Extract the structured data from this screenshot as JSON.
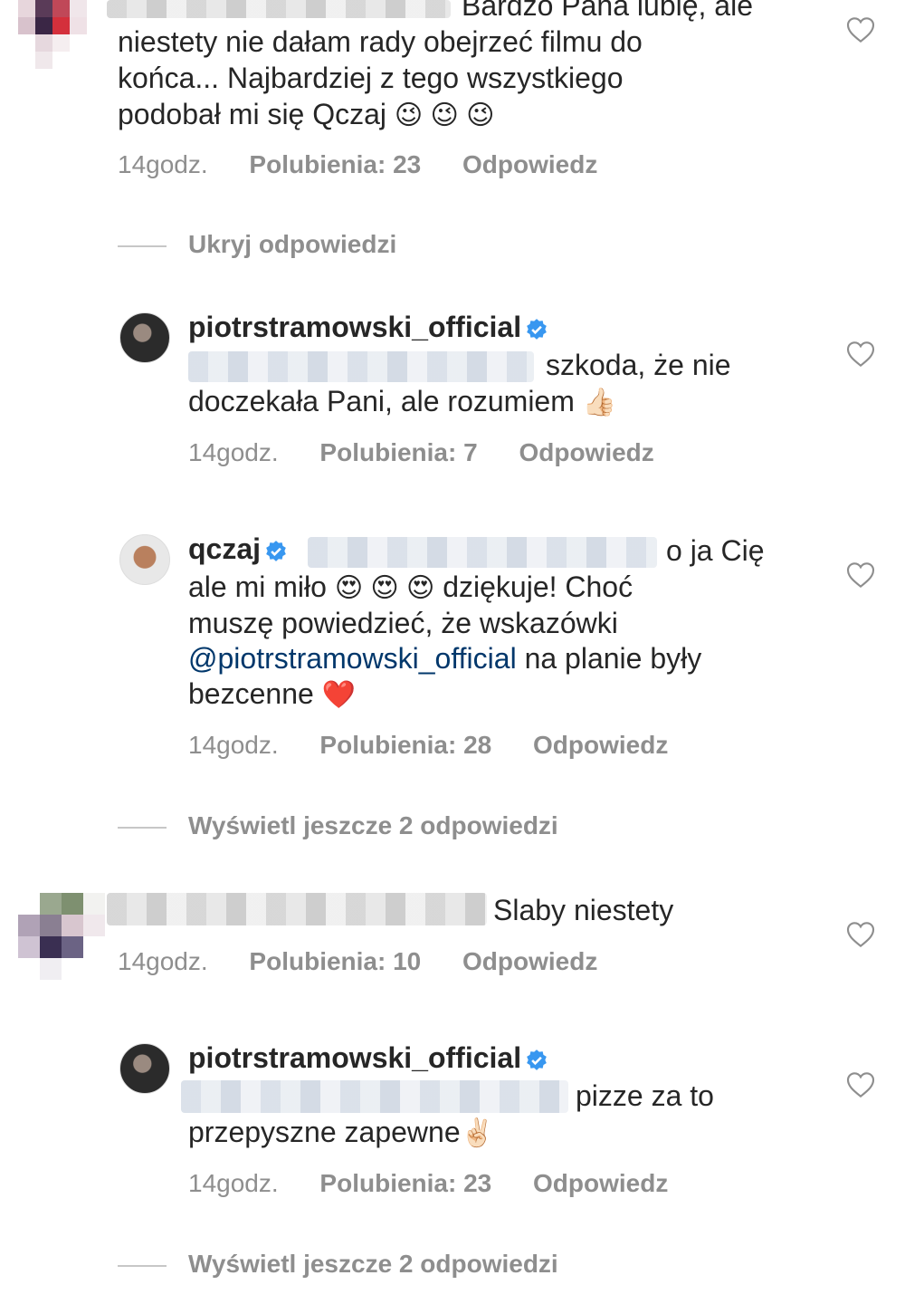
{
  "comment1": {
    "text_line0": "Bardzo Pana lubię, ale",
    "text_lines": [
      "niestety nie dałam rady obejrzeć filmu do",
      "końca... Najbardziej z tego wszystkiego",
      "podobał mi się Qczaj"
    ],
    "emoji": "😉 😉 😉",
    "time": "14godz.",
    "likes": "Polubienia: 23",
    "reply": "Odpowiedz"
  },
  "hide_replies": "Ukryj odpowiedzi",
  "reply1": {
    "username": "piotrstramowski_official",
    "text_after_blur": "szkoda, że nie",
    "text_line2": "doczekała Pani, ale rozumiem",
    "emoji": "👍🏻",
    "time": "14godz.",
    "likes": "Polubienia: 7",
    "reply": "Odpowiedz"
  },
  "reply2": {
    "username": "qczaj",
    "text_after_blur": "o ja Cię",
    "line2_a": "ale mi miło",
    "line2_emoji": "😍 😍 😍",
    "line2_b": "dziękuje! Choć",
    "line3": "muszę powiedzieć, że wskazówki",
    "mention": "@piotrstramowski_official",
    "line4_b": " na planie były",
    "line5": "bezcenne",
    "line5_emoji": "❤️",
    "time": "14godz.",
    "likes": "Polubienia: 28",
    "reply": "Odpowiedz"
  },
  "more_replies_1": "Wyświetl jeszcze 2 odpowiedzi",
  "comment2": {
    "text": "Slaby niestety",
    "time": "14godz.",
    "likes": "Polubienia: 10",
    "reply": "Odpowiedz"
  },
  "reply3": {
    "username": "piotrstramowski_official",
    "text_after_blur": "pizze za to",
    "text_line2": "przepyszne zapewne",
    "emoji": "✌🏻",
    "time": "14godz.",
    "likes": "Polubienia: 23",
    "reply": "Odpowiedz"
  },
  "more_replies_2": "Wyświetl jeszcze 2 odpowiedzi",
  "colors": {
    "verified": "#3897f0",
    "mention": "#00376b",
    "meta": "#8e8e8e"
  },
  "icons": [
    "heart-icon",
    "verified-icon"
  ]
}
